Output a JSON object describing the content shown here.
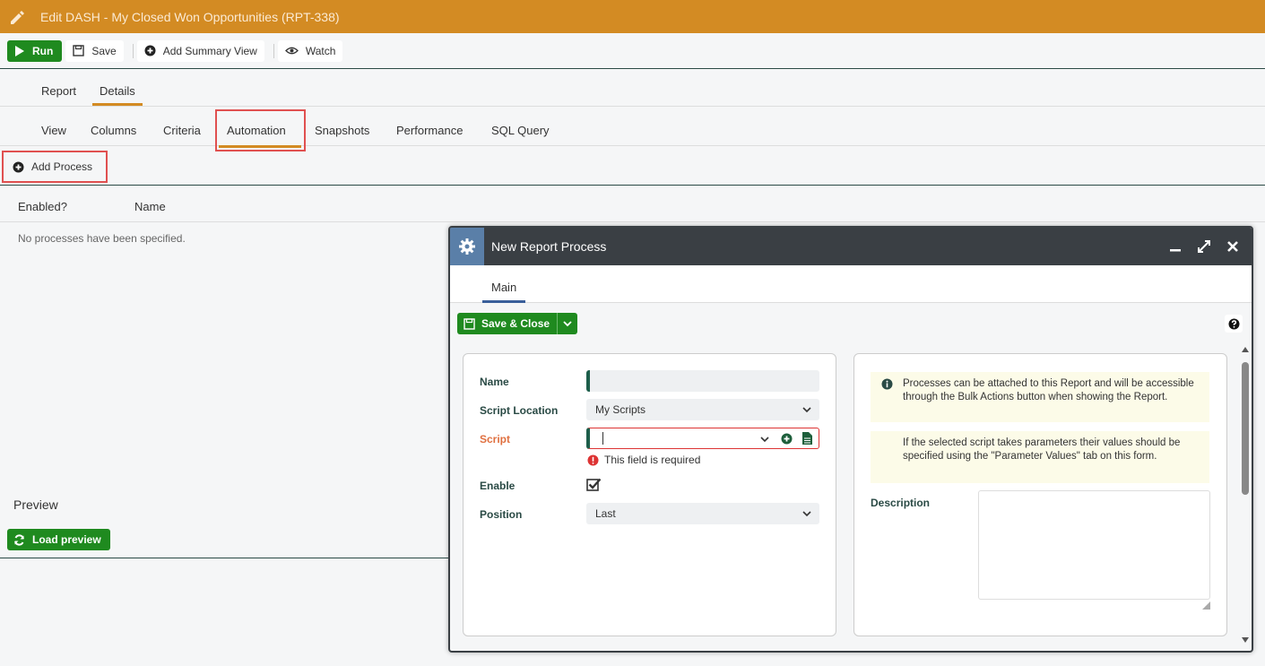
{
  "header": {
    "title": "Edit DASH - My Closed Won Opportunities (RPT-338)",
    "icon": "pencil-icon"
  },
  "toolbar": {
    "run": "Run",
    "save": "Save",
    "add_summary": "Add Summary View",
    "watch": "Watch"
  },
  "main_tabs": [
    "Report",
    "Details"
  ],
  "sub_tabs": [
    "View",
    "Columns",
    "Criteria",
    "Automation",
    "Snapshots",
    "Performance",
    "SQL Query"
  ],
  "add_process": "Add Process",
  "table": {
    "col_enabled": "Enabled?",
    "col_name": "Name",
    "empty": "No processes have been specified."
  },
  "preview": {
    "title": "Preview",
    "load": "Load preview"
  },
  "dialog": {
    "title": "New Report Process",
    "tab": "Main",
    "save_close": "Save & Close",
    "fields": {
      "name_label": "Name",
      "name_value": "",
      "location_label": "Script Location",
      "location_value": "My Scripts",
      "script_label": "Script",
      "script_value": "",
      "required": "This field is required",
      "enable_label": "Enable",
      "position_label": "Position",
      "position_value": "Last"
    },
    "info1": "Processes can be attached to this Report and will be accessible through the Bulk Actions button when showing the Report.",
    "info2": "If the selected script takes parameters their values should be specified using the \"Parameter Values\" tab on this form.",
    "description_label": "Description",
    "description_value": ""
  },
  "colors": {
    "header": "#d38b23",
    "green": "#1f8a1f",
    "dialog_head": "#3a3f44",
    "error": "#d33"
  }
}
